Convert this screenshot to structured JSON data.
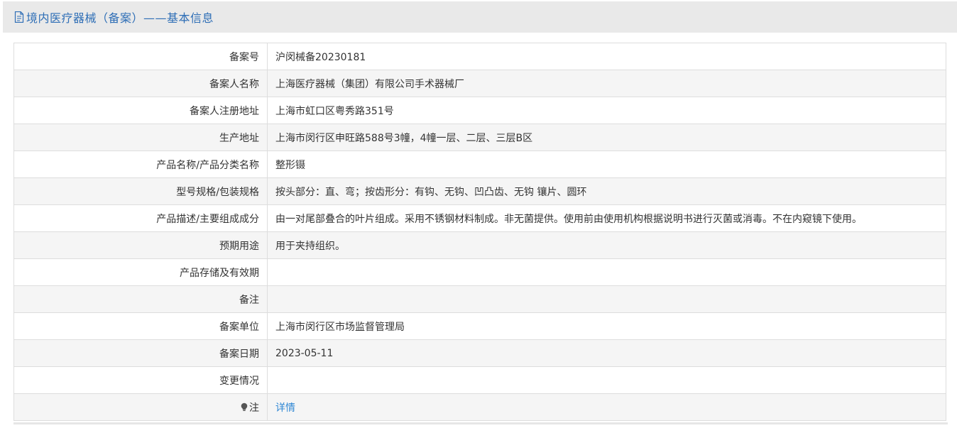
{
  "header": {
    "title": "境内医疗器械（备案）——基本信息",
    "icon": "document-icon",
    "color": "#2e6eb6"
  },
  "rows": [
    {
      "label": "备案号",
      "value": "沪闵械备20230181"
    },
    {
      "label": "备案人名称",
      "value": "上海医疗器械（集团）有限公司手术器械厂"
    },
    {
      "label": "备案人注册地址",
      "value": "上海市虹口区粤秀路351号"
    },
    {
      "label": "生产地址",
      "value": "上海市闵行区申旺路588号3幢，4幢一层、二层、三层B区"
    },
    {
      "label": "产品名称/产品分类名称",
      "value": "整形镊"
    },
    {
      "label": "型号规格/包装规格",
      "value": "按头部分：直、弯；按齿形分：有钩、无钩、凹凸齿、无钩 镶片、圆环"
    },
    {
      "label": "产品描述/主要组成成分",
      "value": "由一对尾部叠合的叶片组成。采用不锈钢材料制成。非无菌提供。使用前由使用机构根据说明书进行灭菌或消毒。不在内窥镜下使用。"
    },
    {
      "label": "预期用途",
      "value": "用于夹持组织。"
    },
    {
      "label": "产品存储及有效期",
      "value": ""
    },
    {
      "label": "备注",
      "value": ""
    },
    {
      "label": "备案单位",
      "value": "上海市闵行区市场监督管理局"
    },
    {
      "label": "备案日期",
      "value": "2023-05-11"
    },
    {
      "label": "变更情况",
      "value": ""
    }
  ],
  "note_row": {
    "label": "注",
    "icon": "lightbulb-icon",
    "link": "详情",
    "link_color": "#2f87d4"
  }
}
